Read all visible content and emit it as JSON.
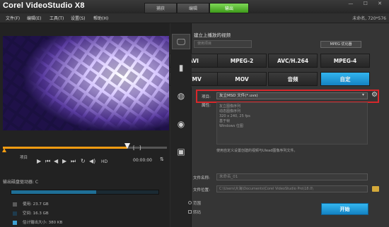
{
  "window": {
    "app_title": "Corel VideoStudio X8",
    "project_info": "未命名, 720*576",
    "buttons": "— ☐ ✕"
  },
  "tabs": [
    "捕获",
    "编辑",
    "输出"
  ],
  "menu": [
    "文件(F)",
    "编辑(E)",
    "工具(T)",
    "设置(S)",
    "帮助(H)"
  ],
  "preview": {
    "trim_label": "项目",
    "hd_label": "HD",
    "timecode": "00:00:00",
    "mark_in": "[",
    "mark_out": "]",
    "playhead_fraction": 0.76
  },
  "disk": {
    "title": "输出磁盘驱动器: C",
    "used_fraction": 0.57,
    "items": [
      {
        "label": "使用: 23.7 GB",
        "color": "#5a5a5a"
      },
      {
        "label": "空间: 16.3 GB",
        "color": "#1f3b4d"
      },
      {
        "label": "估计输出大小: 380 KB",
        "color": "#3fa0d2"
      }
    ]
  },
  "right": {
    "section_title": "建立上播放的视频",
    "device_placeholder": "使用项目",
    "mpeg_opt": "MPEG 优化器",
    "formats": [
      "AVI",
      "MPEG-2",
      "AVC/H.264",
      "MPEG-4",
      "WMV",
      "MOV",
      "音频",
      "自定"
    ],
    "selected_format": "自定",
    "project_label": "项目:",
    "project_value": "友立MSD 文件(*.uvs)",
    "attr_label": "属性:",
    "attr_lines": [
      "友立图像序列",
      "动态图像序列",
      "320 x 240, 25 fps",
      "基于帧",
      "Windows 位图"
    ],
    "hint": "使用自定义设置创建的视频与Ulead图像序列文件。",
    "filename_label": "文件名称:",
    "filename_value": "未命名_01",
    "location_label": "文件位置:",
    "location_value": "C:\\Users\\大海\\Documents\\Corel VideoStudio Pro\\18.0\\",
    "range_label": "范围",
    "bitrate_label": "转码",
    "start": "开始"
  }
}
